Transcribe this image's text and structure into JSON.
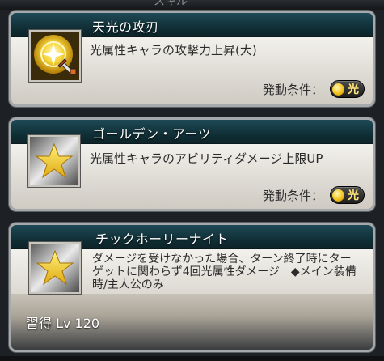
{
  "header": {
    "partial_title": "スキル"
  },
  "skills": [
    {
      "name": "天光の攻刃",
      "description": "光属性キャラの攻撃力上昇(大)",
      "trigger_label": "発動条件：",
      "trigger_element": "光",
      "icon": "sun-sword-icon"
    },
    {
      "name": "ゴールデン・アーツ",
      "description": "光属性キャラのアビリティダメージ上限UP",
      "trigger_label": "発動条件：",
      "trigger_element": "光",
      "icon": "star-icon"
    },
    {
      "name": "チックホーリーナイト",
      "description": "ダメージを受けなかった場合、ターン終了時にターゲットに関わらず4回光属性ダメージ　◆メイン装備時/主人公のみ",
      "learn_label": "習得 Lv 120",
      "icon": "star-icon"
    }
  ],
  "colors": {
    "header_teal": "#1e4a56",
    "light_element": "#f2c31b",
    "star_gold": "#f5d22e"
  }
}
